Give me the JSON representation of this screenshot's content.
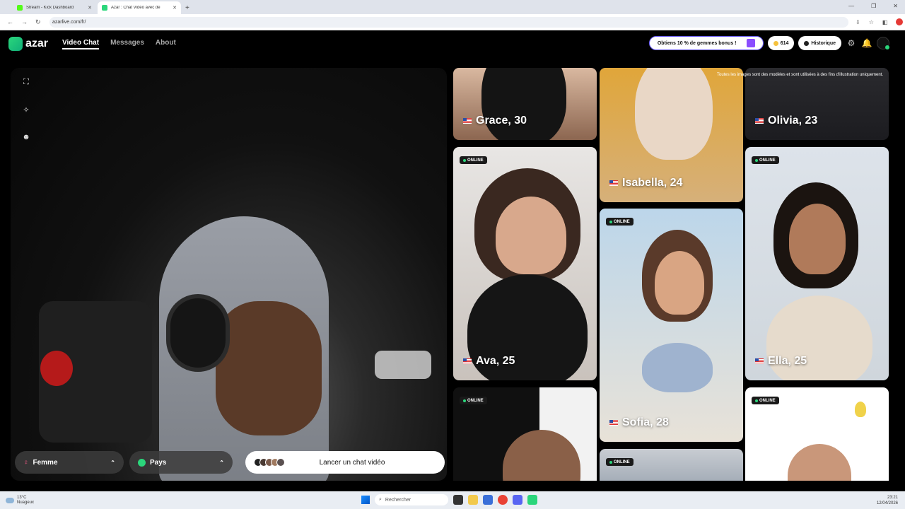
{
  "browser": {
    "tabs": [
      {
        "title": "Stream - Kick Dashboard",
        "active": false
      },
      {
        "title": "Azar : Chat Vidéo avec de",
        "active": true
      }
    ],
    "url": "azarlive.com/fr/"
  },
  "header": {
    "logo_text": "azar",
    "nav": [
      {
        "label": "Video Chat",
        "active": true
      },
      {
        "label": "Messages",
        "active": false
      },
      {
        "label": "About",
        "active": false
      }
    ],
    "bonus_label": "Obtiens 10 % de gemmes bonus !",
    "gems_count": "614",
    "history_label": "Historique"
  },
  "video": {
    "gender_label": "Femme",
    "country_label": "Pays",
    "start_label": "Lancer un chat vidéo"
  },
  "grid": {
    "disclaimer": "Toutes les images sont des modèles et sont utilisées à des fins d'illustration uniquement.",
    "online_label": "ONLINE",
    "profiles": [
      {
        "name": "Grace, 30",
        "online": false
      },
      {
        "name": "Isabella, 24",
        "online": false
      },
      {
        "name": "Olivia, 23",
        "online": false
      },
      {
        "name": "Ava, 25",
        "online": true
      },
      {
        "name": "Sofia, 28",
        "online": true
      },
      {
        "name": "Ella, 25",
        "online": true
      },
      {
        "name": "",
        "online": true
      },
      {
        "name": "",
        "online": true
      },
      {
        "name": "",
        "online": true
      }
    ]
  },
  "taskbar": {
    "temp": "13°C",
    "weather": "Nuageux",
    "search_placeholder": "Rechercher",
    "time": "23:21",
    "date": "12/04/2026"
  },
  "colors": {
    "brand": "#2bd67b",
    "bonus_border": "#6a5cff"
  }
}
